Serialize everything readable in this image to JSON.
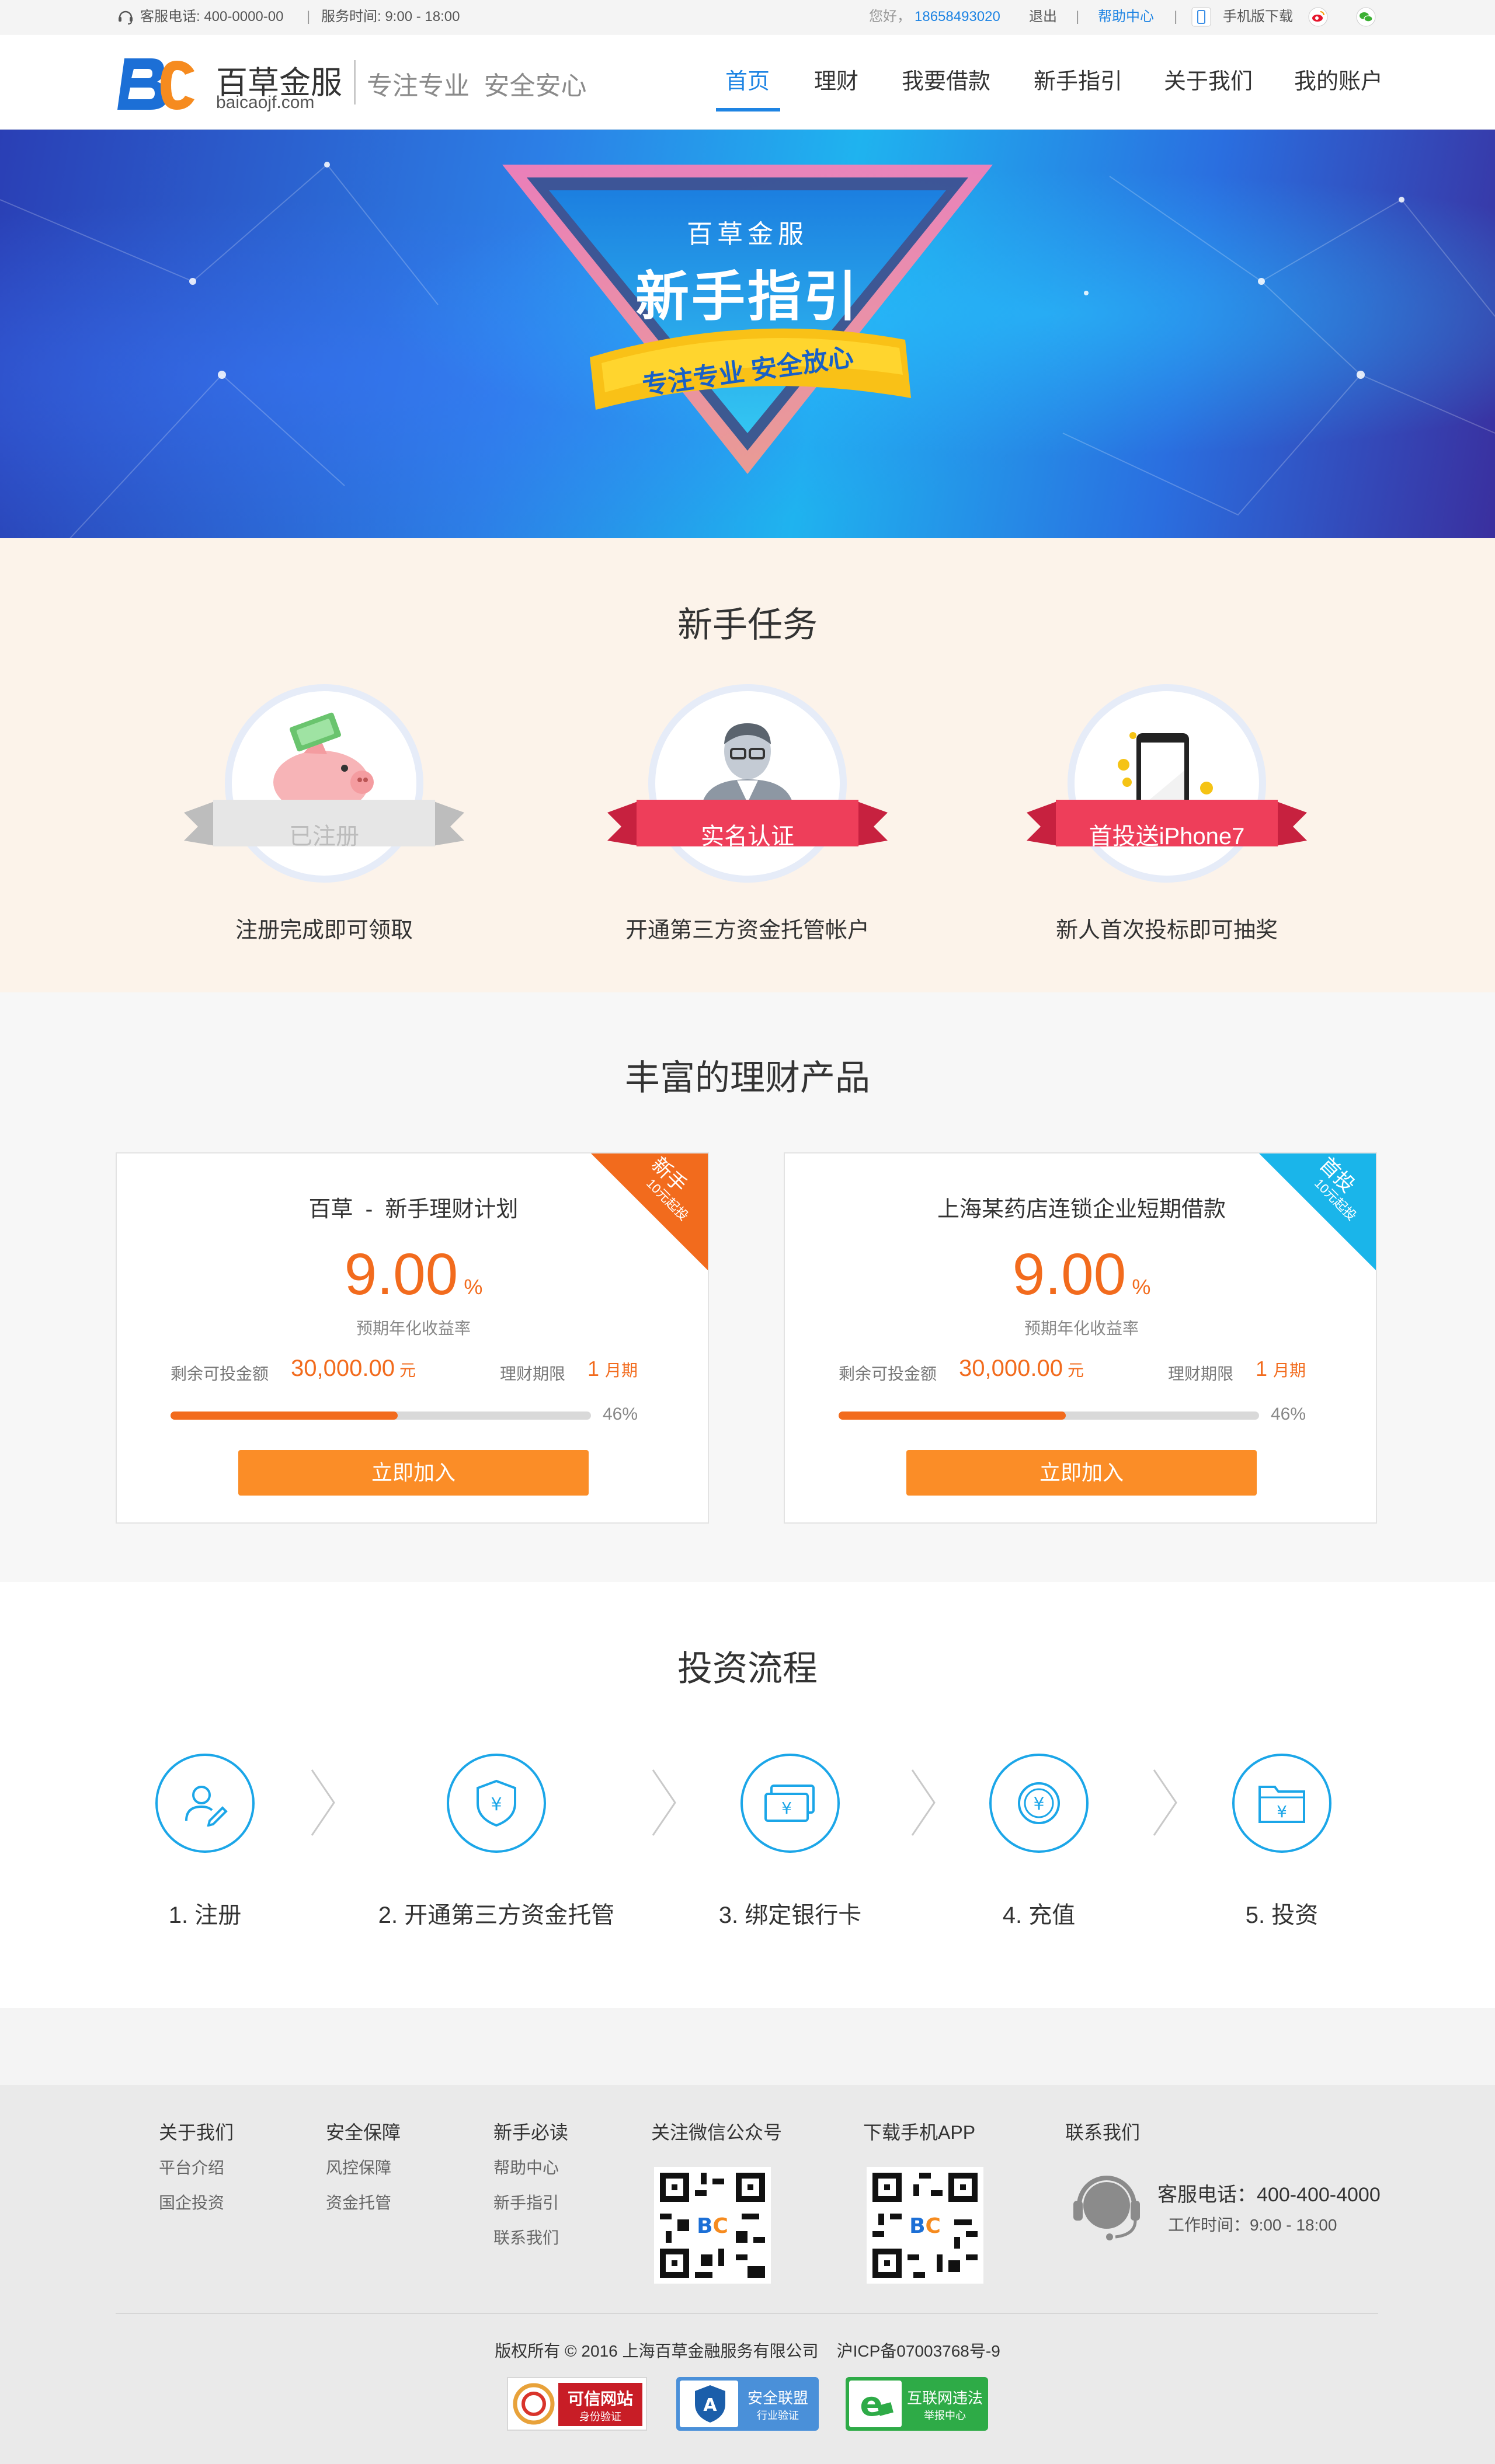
{
  "topbar": {
    "hotline": "客服电话: 400-0000-00",
    "hours": "服务时间: 9:00 - 18:00",
    "greeting": "您好，",
    "phone": "18658493020",
    "logout": "退出",
    "help": "帮助中心",
    "mobile": "手机版下载"
  },
  "brand": {
    "name": "百草金服",
    "domain": "baicaojf.com",
    "slogan": "专注专业  安全安心",
    "mark": "BC"
  },
  "nav": {
    "items": [
      {
        "label": "首页"
      },
      {
        "label": "理财"
      },
      {
        "label": "我要借款"
      },
      {
        "label": "新手指引"
      },
      {
        "label": "关于我们"
      },
      {
        "label": "我的账户"
      }
    ]
  },
  "banner": {
    "brand": "百草金服",
    "title": "新手指引",
    "ribbon": "专注专业 安全放心"
  },
  "tasks": {
    "title": "新手任务",
    "items": [
      {
        "badge": "已注册",
        "desc": "注册完成即可领取"
      },
      {
        "badge": "实名认证",
        "desc": "开通第三方资金托管帐户"
      },
      {
        "badge": "首投送iPhone7",
        "desc": "新人首次投标即可抽奖"
      }
    ]
  },
  "products": {
    "title": "丰富的理财产品",
    "items": [
      {
        "name": "百草  -  新手理财计划",
        "rate": "9.00",
        "rate_unit": "%",
        "rate_label": "预期年化收益率",
        "remain_label": "剩余可投金额",
        "remain": "30,000.00",
        "remain_unit": "元",
        "term_label": "理财期限",
        "term": "1",
        "term_unit": "月期",
        "progress": 0.54,
        "progress_text": "46%",
        "button": "立即加入",
        "corner_top": "新手",
        "corner_bottom": "10元起投",
        "corner_color": "#f26b1d"
      },
      {
        "name": "上海某药店连锁企业短期借款",
        "rate": "9.00",
        "rate_unit": "%",
        "rate_label": "预期年化收益率",
        "remain_label": "剩余可投金额",
        "remain": "30,000.00",
        "remain_unit": "元",
        "term_label": "理财期限",
        "term": "1",
        "term_unit": "月期",
        "progress": 0.54,
        "progress_text": "46%",
        "button": "立即加入",
        "corner_top": "首投",
        "corner_bottom": "10元起投",
        "corner_color": "#1ab5ea"
      }
    ]
  },
  "process": {
    "title": "投资流程",
    "steps": [
      {
        "label": "1. 注册",
        "icon": "user-edit-icon"
      },
      {
        "label": "2. 开通第三方资金托管",
        "icon": "shield-yuan-icon"
      },
      {
        "label": "3. 绑定银行卡",
        "icon": "bank-card-icon"
      },
      {
        "label": "4. 充值",
        "icon": "coin-yuan-icon"
      },
      {
        "label": "5. 投资",
        "icon": "folder-yuan-icon"
      }
    ]
  },
  "footer": {
    "columns": [
      {
        "head": "关于我们",
        "links": [
          "平台介绍",
          "国企投资"
        ]
      },
      {
        "head": "安全保障",
        "links": [
          "风控保障",
          "资金托管"
        ]
      },
      {
        "head": "新手必读",
        "links": [
          "帮助中心",
          "新手指引",
          "联系我们"
        ]
      }
    ],
    "wechat": "关注微信公众号",
    "app": "下载手机APP",
    "contact_head": "联系我们",
    "contact_phone": "客服电话：400-400-4000",
    "contact_hours": "工作时间：9:00 - 18:00",
    "copyright": "版权所有 © 2016 上海百草金融服务有限公司    沪ICP备07003768号-9",
    "badges": [
      {
        "title": "可信网站",
        "sub": "身份验证"
      },
      {
        "title": "安全联盟",
        "sub": "行业验证"
      },
      {
        "title": "互联网违法",
        "sub": "举报中心"
      }
    ]
  },
  "colors": {
    "primary": "#1e84e3",
    "orange": "#fb8d27",
    "rate": "#f26b1d",
    "tasks_bg": "#fcf3ea",
    "products_bg": "#f7f7f7"
  }
}
